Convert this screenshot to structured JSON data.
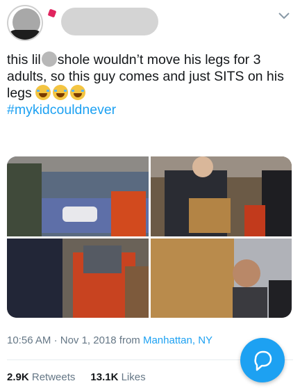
{
  "tweet": {
    "text_part1": "this lil",
    "text_part2": "shole wouldn’t move his legs for 3 adults, so this guy comes and just SITS on his legs",
    "hashtag": "#mykidcouldnever",
    "emoji_icon": "face-with-tears-of-joy-icon",
    "emoji_count": 3
  },
  "meta": {
    "time": "10:56 AM",
    "separator": "·",
    "date": "Nov 1, 2018",
    "from": "from",
    "place": "Manhattan, NY"
  },
  "stats": {
    "retweets_count": "2.9K",
    "retweets_label": "Retweets",
    "likes_count": "13.1K",
    "likes_label": "Likes"
  },
  "colors": {
    "link": "#1da1f2",
    "text": "#14171a",
    "secondary": "#657786",
    "fab": "#1da1f2"
  }
}
